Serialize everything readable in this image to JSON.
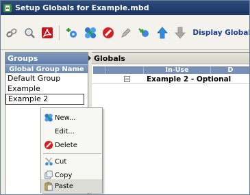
{
  "window": {
    "title": "Setup Globals for Example.mbd"
  },
  "toolbar": {
    "display_label": "Display Global"
  },
  "groups": {
    "pane_title": "Groups",
    "column_header": "Global Group Name",
    "items": [
      {
        "label": "Default Group"
      },
      {
        "label": "Example"
      },
      {
        "label": "Example 2",
        "selected": true
      }
    ]
  },
  "globals": {
    "pane_title": "Globals",
    "columns": [
      {
        "label": "In-Use"
      },
      {
        "label": "D"
      }
    ],
    "rows": [
      {
        "name": "Example 2 - Optional",
        "expanded": false
      }
    ]
  },
  "context_menu": {
    "items": [
      {
        "label": "New...",
        "icon": "new-icon"
      },
      {
        "label": "Edit...",
        "icon": ""
      },
      {
        "label": "Delete",
        "icon": "delete-icon"
      },
      {
        "label": "Cut",
        "icon": "cut-icon"
      },
      {
        "label": "Copy",
        "icon": "copy-icon"
      },
      {
        "label": "Paste",
        "icon": "paste-icon",
        "highlighted": true
      }
    ]
  },
  "colors": {
    "title_bar": "#1a3461",
    "pane_header": "#6b87af",
    "toolbar_text": "#1d3c8f",
    "delete_red": "#d81e1e"
  }
}
